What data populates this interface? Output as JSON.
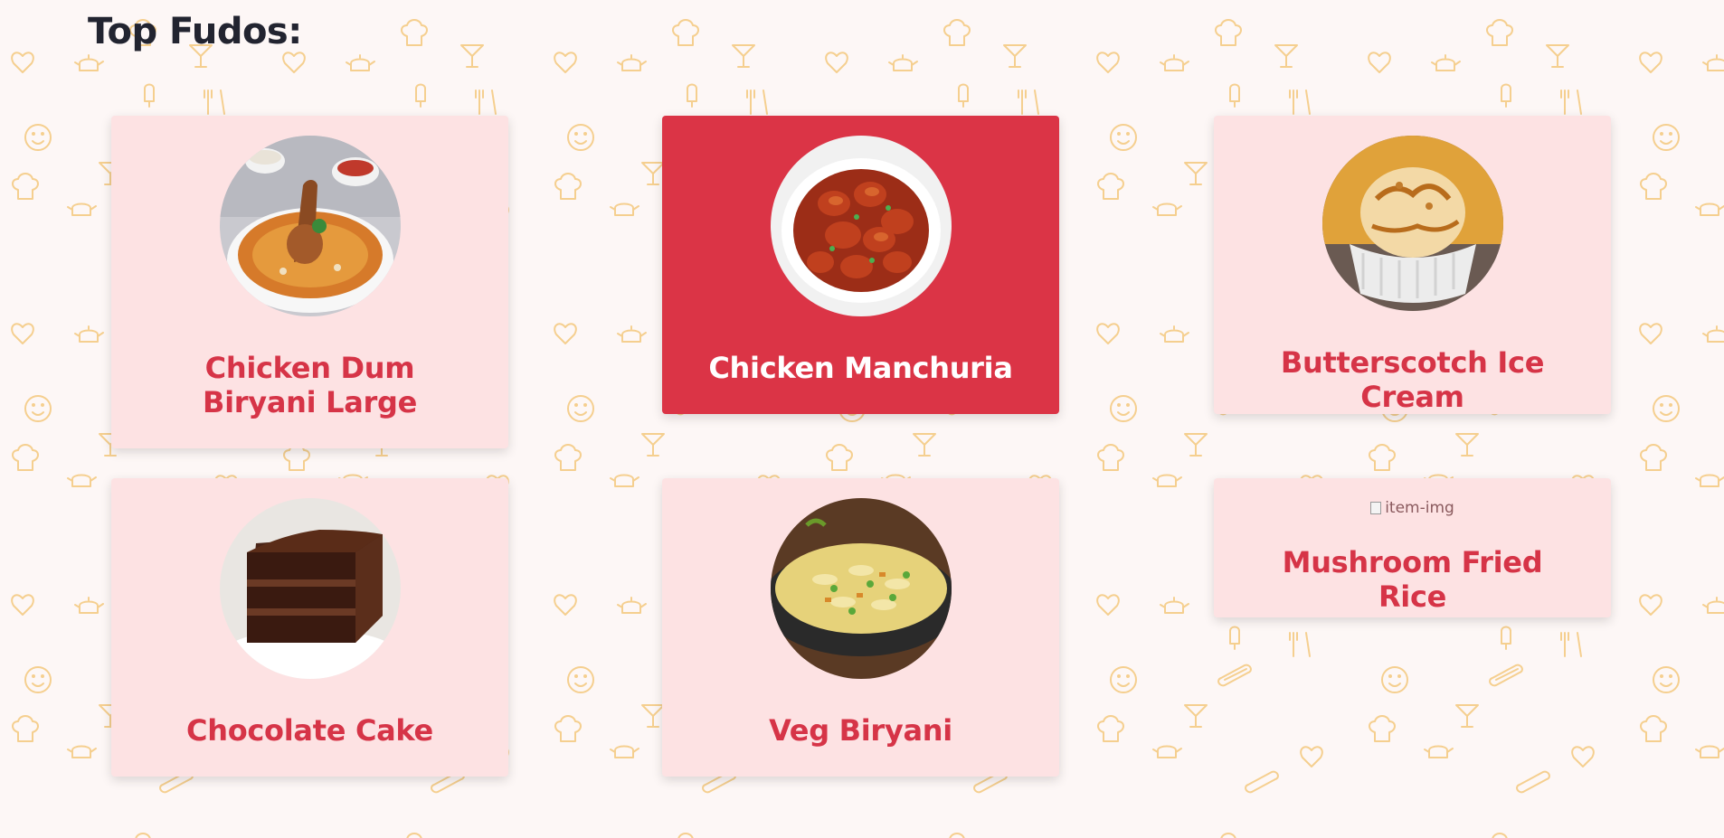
{
  "page": {
    "title": "Top Fudos:"
  },
  "cards": [
    {
      "name": "Chicken Dum Biryani Large",
      "image_icon": "biryani-chicken-photo",
      "active": false
    },
    {
      "name": "Chicken Manchuria",
      "image_icon": "chicken-manchurian-photo",
      "active": true
    },
    {
      "name": "Butterscotch Ice Cream",
      "image_icon": "ice-cream-photo",
      "active": false
    },
    {
      "name": "Chocolate Cake",
      "image_icon": "chocolate-cake-photo",
      "active": false
    },
    {
      "name": "Veg Biryani",
      "image_icon": "veg-biryani-photo",
      "active": false
    },
    {
      "name": "Mushroom Fried Rice",
      "image_alt": "item-img",
      "image_icon": "broken-image-icon",
      "active": false
    }
  ],
  "colors": {
    "background": "#fdf7f6",
    "card": "#fde2e3",
    "card_active": "#db3446",
    "accent_text": "#d63447",
    "title_text": "#222430",
    "pattern": "#f5cf8f"
  }
}
